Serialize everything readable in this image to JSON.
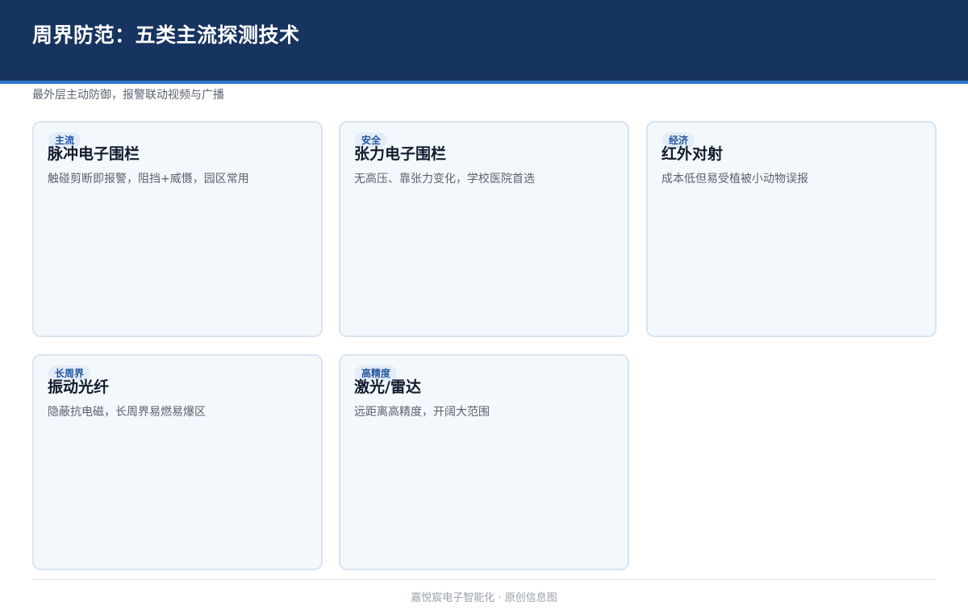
{
  "header": {
    "title": "周界防范：五类主流探测技术",
    "subtitle": "最外层主动防御，报警联动视频与广播"
  },
  "cards": [
    {
      "badge": "主流",
      "title": "脉冲电子围栏",
      "desc": "触碰剪断即报警，阻挡+威慑，园区常用"
    },
    {
      "badge": "安全",
      "title": "张力电子围栏",
      "desc": "无高压、靠张力变化，学校医院首选"
    },
    {
      "badge": "经济",
      "title": "红外对射",
      "desc": "成本低但易受植被小动物误报"
    },
    {
      "badge": "长周界",
      "title": "振动光纤",
      "desc": "隐蔽抗电磁，长周界易燃易爆区"
    },
    {
      "badge": "高精度",
      "title": "激光/雷达",
      "desc": "远距离高精度，开阔大范围"
    }
  ],
  "footer": {
    "text": "嘉悦宸电子智能化 · 原创信息图"
  },
  "colors": {
    "header_bg": "#17335f",
    "accent_line": "#2d78cc",
    "card_bg": "#f3f8fc",
    "card_border": "#d9e4f2",
    "badge_text": "#2456a0"
  }
}
